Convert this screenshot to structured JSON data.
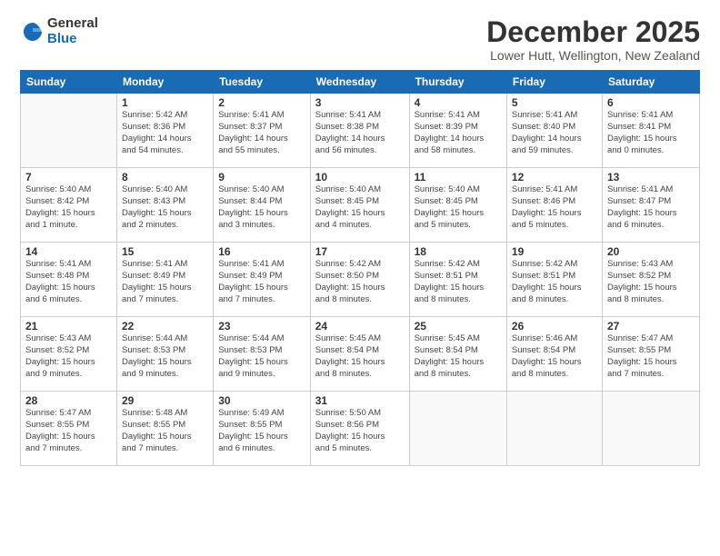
{
  "header": {
    "logo_general": "General",
    "logo_blue": "Blue",
    "title": "December 2025",
    "subtitle": "Lower Hutt, Wellington, New Zealand"
  },
  "calendar": {
    "days_of_week": [
      "Sunday",
      "Monday",
      "Tuesday",
      "Wednesday",
      "Thursday",
      "Friday",
      "Saturday"
    ],
    "weeks": [
      [
        {
          "num": "",
          "info": ""
        },
        {
          "num": "1",
          "info": "Sunrise: 5:42 AM\nSunset: 8:36 PM\nDaylight: 14 hours\nand 54 minutes."
        },
        {
          "num": "2",
          "info": "Sunrise: 5:41 AM\nSunset: 8:37 PM\nDaylight: 14 hours\nand 55 minutes."
        },
        {
          "num": "3",
          "info": "Sunrise: 5:41 AM\nSunset: 8:38 PM\nDaylight: 14 hours\nand 56 minutes."
        },
        {
          "num": "4",
          "info": "Sunrise: 5:41 AM\nSunset: 8:39 PM\nDaylight: 14 hours\nand 58 minutes."
        },
        {
          "num": "5",
          "info": "Sunrise: 5:41 AM\nSunset: 8:40 PM\nDaylight: 14 hours\nand 59 minutes."
        },
        {
          "num": "6",
          "info": "Sunrise: 5:41 AM\nSunset: 8:41 PM\nDaylight: 15 hours\nand 0 minutes."
        }
      ],
      [
        {
          "num": "7",
          "info": "Sunrise: 5:40 AM\nSunset: 8:42 PM\nDaylight: 15 hours\nand 1 minute."
        },
        {
          "num": "8",
          "info": "Sunrise: 5:40 AM\nSunset: 8:43 PM\nDaylight: 15 hours\nand 2 minutes."
        },
        {
          "num": "9",
          "info": "Sunrise: 5:40 AM\nSunset: 8:44 PM\nDaylight: 15 hours\nand 3 minutes."
        },
        {
          "num": "10",
          "info": "Sunrise: 5:40 AM\nSunset: 8:45 PM\nDaylight: 15 hours\nand 4 minutes."
        },
        {
          "num": "11",
          "info": "Sunrise: 5:40 AM\nSunset: 8:45 PM\nDaylight: 15 hours\nand 5 minutes."
        },
        {
          "num": "12",
          "info": "Sunrise: 5:41 AM\nSunset: 8:46 PM\nDaylight: 15 hours\nand 5 minutes."
        },
        {
          "num": "13",
          "info": "Sunrise: 5:41 AM\nSunset: 8:47 PM\nDaylight: 15 hours\nand 6 minutes."
        }
      ],
      [
        {
          "num": "14",
          "info": "Sunrise: 5:41 AM\nSunset: 8:48 PM\nDaylight: 15 hours\nand 6 minutes."
        },
        {
          "num": "15",
          "info": "Sunrise: 5:41 AM\nSunset: 8:49 PM\nDaylight: 15 hours\nand 7 minutes."
        },
        {
          "num": "16",
          "info": "Sunrise: 5:41 AM\nSunset: 8:49 PM\nDaylight: 15 hours\nand 7 minutes."
        },
        {
          "num": "17",
          "info": "Sunrise: 5:42 AM\nSunset: 8:50 PM\nDaylight: 15 hours\nand 8 minutes."
        },
        {
          "num": "18",
          "info": "Sunrise: 5:42 AM\nSunset: 8:51 PM\nDaylight: 15 hours\nand 8 minutes."
        },
        {
          "num": "19",
          "info": "Sunrise: 5:42 AM\nSunset: 8:51 PM\nDaylight: 15 hours\nand 8 minutes."
        },
        {
          "num": "20",
          "info": "Sunrise: 5:43 AM\nSunset: 8:52 PM\nDaylight: 15 hours\nand 8 minutes."
        }
      ],
      [
        {
          "num": "21",
          "info": "Sunrise: 5:43 AM\nSunset: 8:52 PM\nDaylight: 15 hours\nand 9 minutes."
        },
        {
          "num": "22",
          "info": "Sunrise: 5:44 AM\nSunset: 8:53 PM\nDaylight: 15 hours\nand 9 minutes."
        },
        {
          "num": "23",
          "info": "Sunrise: 5:44 AM\nSunset: 8:53 PM\nDaylight: 15 hours\nand 9 minutes."
        },
        {
          "num": "24",
          "info": "Sunrise: 5:45 AM\nSunset: 8:54 PM\nDaylight: 15 hours\nand 8 minutes."
        },
        {
          "num": "25",
          "info": "Sunrise: 5:45 AM\nSunset: 8:54 PM\nDaylight: 15 hours\nand 8 minutes."
        },
        {
          "num": "26",
          "info": "Sunrise: 5:46 AM\nSunset: 8:54 PM\nDaylight: 15 hours\nand 8 minutes."
        },
        {
          "num": "27",
          "info": "Sunrise: 5:47 AM\nSunset: 8:55 PM\nDaylight: 15 hours\nand 7 minutes."
        }
      ],
      [
        {
          "num": "28",
          "info": "Sunrise: 5:47 AM\nSunset: 8:55 PM\nDaylight: 15 hours\nand 7 minutes."
        },
        {
          "num": "29",
          "info": "Sunrise: 5:48 AM\nSunset: 8:55 PM\nDaylight: 15 hours\nand 7 minutes."
        },
        {
          "num": "30",
          "info": "Sunrise: 5:49 AM\nSunset: 8:55 PM\nDaylight: 15 hours\nand 6 minutes."
        },
        {
          "num": "31",
          "info": "Sunrise: 5:50 AM\nSunset: 8:56 PM\nDaylight: 15 hours\nand 5 minutes."
        },
        {
          "num": "",
          "info": ""
        },
        {
          "num": "",
          "info": ""
        },
        {
          "num": "",
          "info": ""
        }
      ]
    ]
  }
}
